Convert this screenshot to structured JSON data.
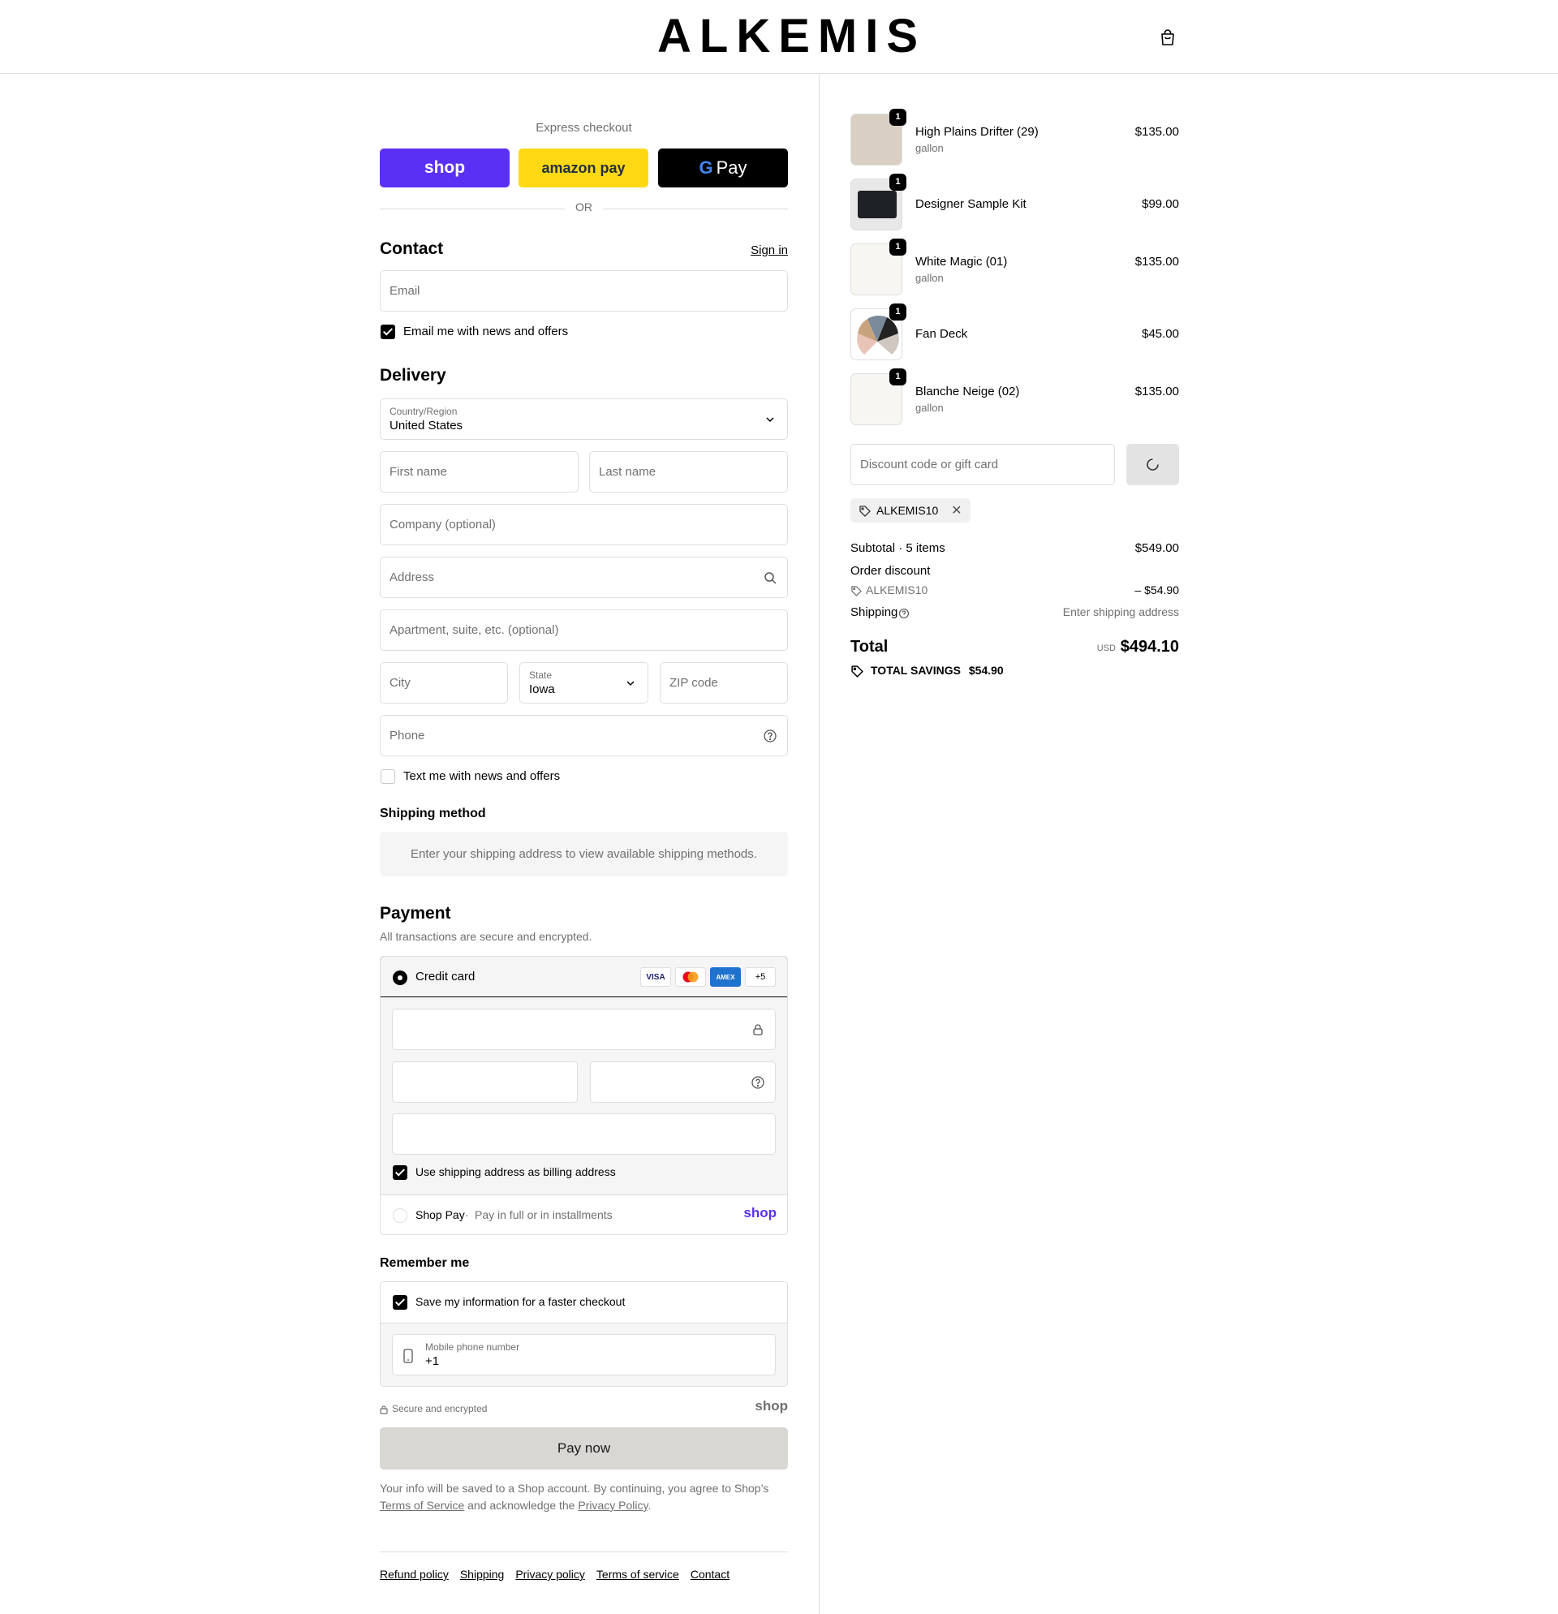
{
  "header": {
    "logo": "ALKEMIS",
    "cart_icon": "shopping-bag-icon"
  },
  "express": {
    "title": "Express checkout",
    "shop_label": "shop",
    "amazon_label": "amazon pay",
    "gpay_label": "Pay",
    "colors": {
      "shop": "#5a31f4",
      "amazon": "#ffd814",
      "gpay": "#000000"
    },
    "or_label": "OR"
  },
  "contact": {
    "heading": "Contact",
    "sign_in": "Sign in",
    "email_placeholder": "Email",
    "news_checkbox": "Email me with news and offers"
  },
  "delivery": {
    "heading": "Delivery",
    "country_label": "Country/Region",
    "country_value": "United States",
    "first_name": "First name",
    "last_name": "Last name",
    "company": "Company (optional)",
    "address": "Address",
    "apartment": "Apartment, suite, etc. (optional)",
    "city": "City",
    "state_label": "State",
    "state_value": "Iowa",
    "zip": "ZIP code",
    "phone": "Phone",
    "text_checkbox": "Text me with news and offers"
  },
  "shipping_method": {
    "heading": "Shipping method",
    "message": "Enter your shipping address to view available shipping methods."
  },
  "payment": {
    "heading": "Payment",
    "subtitle": "All transactions are secure and encrypted.",
    "credit_card": "Credit card",
    "card_logos": [
      "VISA",
      "MC",
      "AMEX"
    ],
    "more_cards": "+5",
    "billing_checkbox": "Use shipping address as billing address",
    "shop_pay": "Shop Pay",
    "shop_pay_desc": "Pay in full or in installments",
    "shop_logo": "shop"
  },
  "remember": {
    "heading": "Remember me",
    "save_checkbox": "Save my information for a faster checkout",
    "mobile_label": "Mobile phone number",
    "mobile_value": "+1",
    "secure": "Secure and encrypted",
    "shop_logo": "shop"
  },
  "pay_now": "Pay now",
  "legal": {
    "line1": "Your info will be saved to a Shop account. By continuing, you agree to Shop’s",
    "terms": "Terms of Service",
    "middle": "and acknowledge the",
    "privacy": "Privacy Policy",
    "end": "."
  },
  "footer": [
    "Refund policy",
    "Shipping",
    "Privacy policy",
    "Terms of service",
    "Contact"
  ],
  "cart": {
    "items": [
      {
        "name": "High Plains Drifter (29)",
        "sub": "gallon",
        "price": "$135.00",
        "qty": "1"
      },
      {
        "name": "Designer Sample Kit",
        "sub": "",
        "price": "$99.00",
        "qty": "1"
      },
      {
        "name": "White Magic (01)",
        "sub": "gallon",
        "price": "$135.00",
        "qty": "1"
      },
      {
        "name": "Fan Deck",
        "sub": "",
        "price": "$45.00",
        "qty": "1"
      },
      {
        "name": "Blanche Neige (02)",
        "sub": "gallon",
        "price": "$135.00",
        "qty": "1"
      }
    ],
    "discount_placeholder": "Discount code or gift card",
    "applied_code": "ALKEMIS10",
    "subtotal_label": "Subtotal · 5 items",
    "subtotal_value": "$549.00",
    "order_discount_label": "Order discount",
    "discount_code": "ALKEMIS10",
    "discount_value": "– $54.90",
    "shipping_label": "Shipping",
    "shipping_value": "Enter shipping address",
    "total_label": "Total",
    "currency": "USD",
    "total_value": "$494.10",
    "savings_label": "TOTAL SAVINGS",
    "savings_value": "$54.90"
  }
}
